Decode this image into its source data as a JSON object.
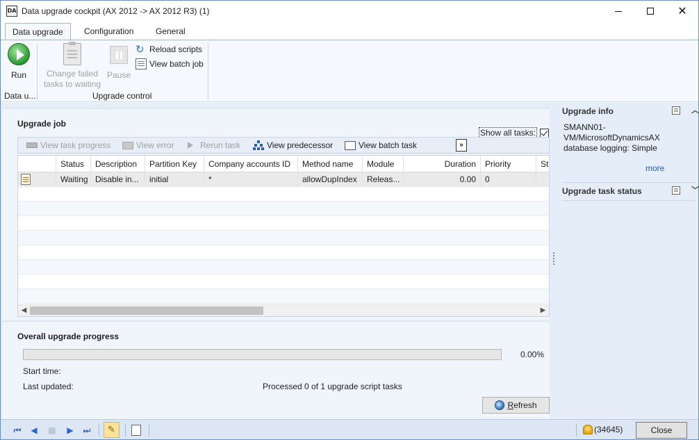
{
  "window": {
    "title": "Data upgrade cockpit (AX 2012 -> AX 2012 R3) (1)",
    "app_icon_text": "DA"
  },
  "ribbon": {
    "tabs": [
      {
        "label": "Data upgrade",
        "active": true
      },
      {
        "label": "Configuration",
        "active": false
      },
      {
        "label": "General",
        "active": false
      }
    ],
    "run_label": "Run",
    "change_failed_label_1": "Change failed",
    "change_failed_label_2": "tasks to waiting",
    "pause_label": "Pause",
    "reload_scripts_label": "Reload scripts",
    "view_batch_job_label": "View batch job",
    "group1_label": "Data u...",
    "group2_label": "Upgrade control"
  },
  "upgrade_job": {
    "title": "Upgrade job",
    "show_all_tasks_label": "Show all tasks:",
    "show_all_tasks_checked": true,
    "toolbar": {
      "view_task_progress": "View task progress",
      "view_error": "View error",
      "rerun_task": "Rerun task",
      "view_predecessor": "View predecessor",
      "view_batch_task": "View batch task",
      "overflow": "»"
    },
    "columns": [
      "Status",
      "Description",
      "Partition Key",
      "Company accounts ID",
      "Method name",
      "Module",
      "Duration",
      "Priority",
      "Sta"
    ],
    "rows": [
      {
        "status": "Waiting",
        "description": "Disable in...",
        "partition_key": "initial",
        "company_accounts_id": "*",
        "method_name": "allowDupIndex",
        "module": "Releas...",
        "duration": "0.00",
        "priority": "0",
        "sta": ""
      }
    ]
  },
  "progress": {
    "title": "Overall upgrade progress",
    "percent_text": "0.00%",
    "percent_value": 0,
    "start_time_label": "Start time:",
    "last_updated_label": "Last updated:",
    "processed_text": "Processed 0 of 1 upgrade script tasks",
    "refresh_label_underlined": "R",
    "refresh_label_rest": "efresh"
  },
  "factbox": {
    "upgrade_info_title": "Upgrade info",
    "info_line1": "SMANN01-",
    "info_line2": "VM/MicrosoftDynamicsAX",
    "info_line3": "database logging: Simple",
    "more_label": "more",
    "task_status_title": "Upgrade task status"
  },
  "statusbar": {
    "first": "⏮",
    "prev": "◀",
    "next": "▶",
    "last": "⏭",
    "notification_count": "(34645)",
    "close_label": "Close"
  },
  "colors": {
    "accent": "#2b66c4",
    "ribbon_bg": "#f5f9fd",
    "pane_bg": "#e4edf8"
  }
}
